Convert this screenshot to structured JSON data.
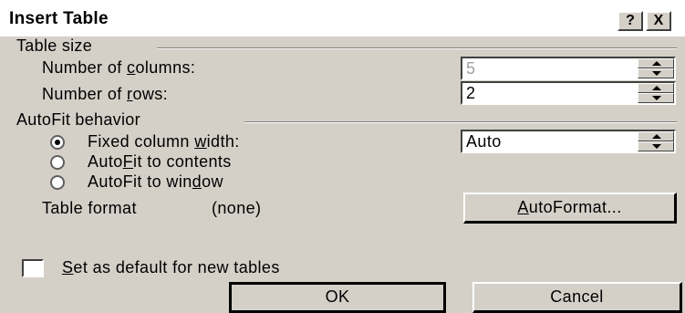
{
  "dialog": {
    "title": "Insert Table",
    "help_button": "?",
    "close_button": "X"
  },
  "table_size": {
    "group_label": "Table size",
    "columns_label_pre": "Number of ",
    "columns_label_accel": "c",
    "columns_label_post": "olumns:",
    "columns_value": "5",
    "rows_label_pre": "Number of ",
    "rows_label_accel": "r",
    "rows_label_post": "ows:",
    "rows_value": "2"
  },
  "autofit": {
    "group_label": "AutoFit behavior",
    "options": [
      {
        "pre": "Fixed column ",
        "accel": "w",
        "post": "idth:",
        "selected": true
      },
      {
        "pre": "Auto",
        "accel": "F",
        "post": "it to contents",
        "selected": false
      },
      {
        "pre": "AutoFit to win",
        "accel": "d",
        "post": "ow",
        "selected": false
      }
    ],
    "fixed_width_value": "Auto"
  },
  "table_format": {
    "label": "Table format",
    "value": "(none)",
    "autoformat_accel": "A",
    "autoformat_rest": "utoFormat..."
  },
  "default_checkbox": {
    "accel": "S",
    "rest": "et as default for new tables",
    "checked": false
  },
  "buttons": {
    "ok": "OK",
    "cancel": "Cancel"
  }
}
